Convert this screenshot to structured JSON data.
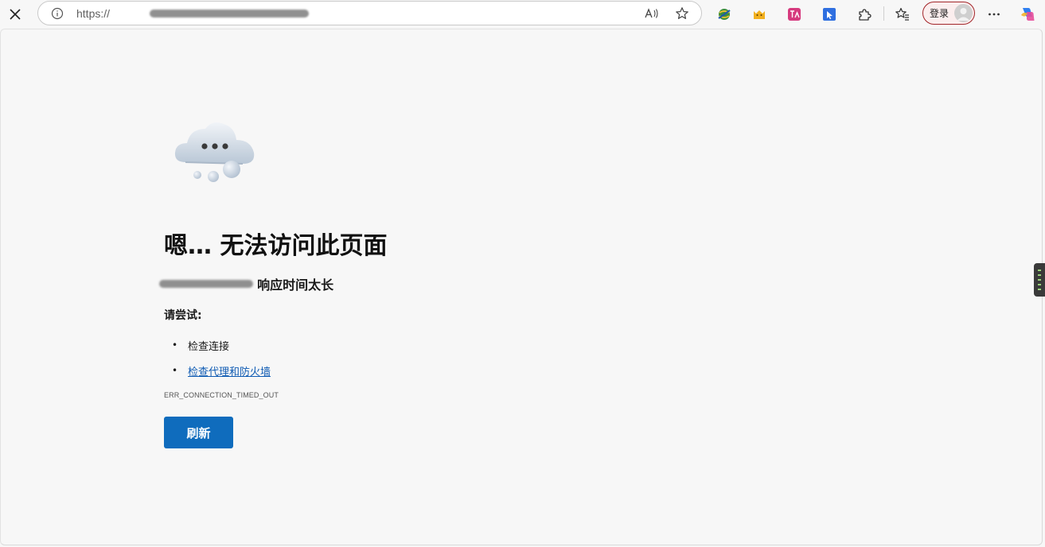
{
  "browser": {
    "address_url": "https://",
    "login_label": "登录",
    "icons": {
      "stop": "close-icon",
      "info": "info-icon",
      "read_aloud": "read-aloud-icon",
      "favorite": "star-icon",
      "ext1": "globe-extension-icon",
      "ext2": "cat-extension-icon",
      "ext3": "translate-extension-icon",
      "ext4": "cursor-extension-icon",
      "extensions": "puzzle-icon",
      "favorites": "favorites-icon",
      "more": "more-icon",
      "copilot": "copilot-icon"
    }
  },
  "error_page": {
    "title": "嗯… 无法访问此页面",
    "description_suffix": "响应时间太长",
    "try_heading": "请尝试:",
    "suggestions": [
      {
        "text": "检查连接",
        "is_link": false
      },
      {
        "text": "检查代理和防火墙",
        "is_link": true
      }
    ],
    "error_code": "ERR_CONNECTION_TIMED_OUT",
    "refresh_label": "刷新"
  },
  "colors": {
    "accent": "#0f6cbd",
    "link": "#0f5bb3",
    "page_bg": "#f7f7f7",
    "login_border": "#a3262a"
  }
}
